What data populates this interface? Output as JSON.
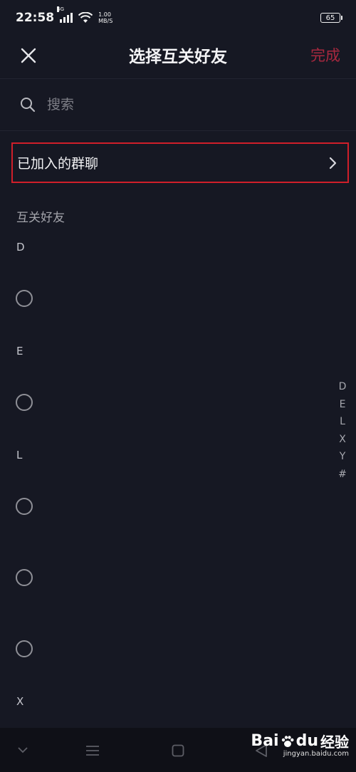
{
  "status_bar": {
    "time": "22:58",
    "network": "4G",
    "speed_value": "1.00",
    "speed_unit": "MB/S",
    "battery": "65"
  },
  "header": {
    "title": "选择互关好友",
    "done_label": "完成",
    "done_color": "#a8283f"
  },
  "search": {
    "placeholder": "搜索"
  },
  "group_chat": {
    "label": "已加入的群聊",
    "highlight_color": "#d01f2a"
  },
  "friends_section": {
    "title": "互关好友",
    "groups": [
      {
        "letter": "D",
        "items": [
          {
            "name": ""
          }
        ]
      },
      {
        "letter": "E",
        "items": [
          {
            "name": ""
          }
        ]
      },
      {
        "letter": "L",
        "items": [
          {
            "name": ""
          },
          {
            "name": ""
          },
          {
            "name": ""
          }
        ]
      },
      {
        "letter": "X",
        "items": []
      }
    ]
  },
  "index_bar": {
    "letters": [
      "D",
      "E",
      "L",
      "X",
      "Y",
      "#"
    ]
  },
  "watermark": {
    "brand": "Bai",
    "brand_suffix": "du",
    "brand_cn": "经验",
    "url": "jingyan.baidu.com"
  },
  "icons": {
    "close": "close-icon",
    "search": "search-icon",
    "chevron": "chevron-right-icon"
  }
}
